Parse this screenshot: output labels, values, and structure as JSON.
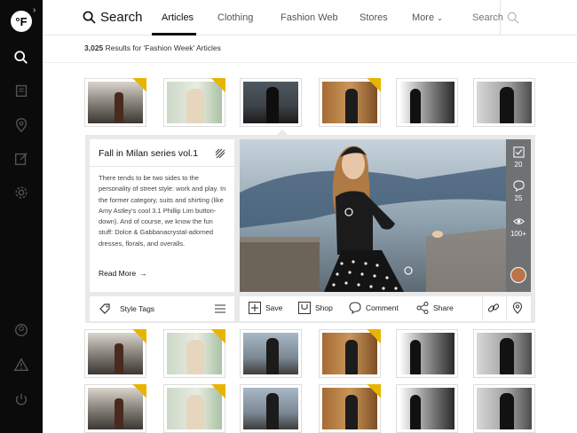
{
  "app": {
    "logo_text": "°F",
    "expand_glyph": "›"
  },
  "sidebar": {
    "items": [
      {
        "icon": "search-icon"
      },
      {
        "icon": "bookmarks-icon"
      },
      {
        "icon": "location-pin-icon"
      },
      {
        "icon": "edit-icon"
      },
      {
        "icon": "settings-icon"
      },
      {
        "icon": "profile-icon"
      },
      {
        "icon": "alert-icon"
      },
      {
        "icon": "power-icon"
      }
    ]
  },
  "nav": {
    "search_label": "Search",
    "tabs": [
      {
        "label": "Articles",
        "active": true
      },
      {
        "label": "Clothing",
        "active": false
      },
      {
        "label": "Fashion Web",
        "active": false
      },
      {
        "label": "Stores",
        "active": false
      },
      {
        "label": "More",
        "active": false
      }
    ],
    "search_placeholder": "Search"
  },
  "results": {
    "count": "3,025",
    "text": "Results for 'Fashion Week' Articles"
  },
  "article": {
    "title": "Fall in Milan series vol.1",
    "body": "There tends to be two sides to the personality of street style: work and play. In the former category, suits and shirting (like Amy Astley's cool 3.1 Phillip Lim button-down). And of course, we know the fun stuff: Dolce & Gabbanacrystal-adorned dresses, florals, and overalls.",
    "read_more": "Read More",
    "style_tags_label": "Style Tags"
  },
  "stats": {
    "likes": "20",
    "comments": "25",
    "views": "100+"
  },
  "actions": {
    "save": "Save",
    "shop": "Shop",
    "comment": "Comment",
    "share": "Share"
  },
  "colors": {
    "sidebar": "#0b0b0b",
    "ribbon": "#e8b400",
    "panel": "#e9e9e9",
    "stats_bar": "#6f7275"
  }
}
